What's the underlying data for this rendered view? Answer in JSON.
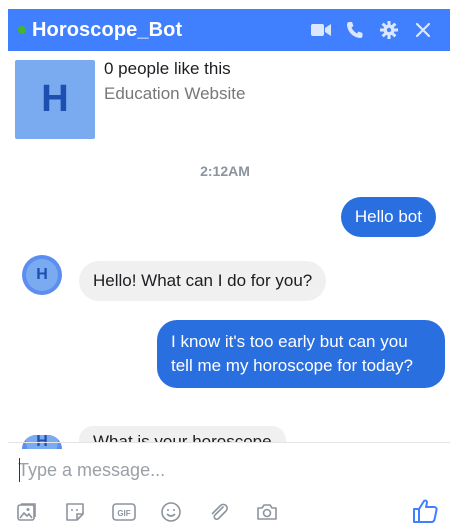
{
  "header": {
    "title": "Horoscope_Bot",
    "status": "online",
    "colors": {
      "bar": "#4080ff",
      "status_dot": "#42b72a"
    },
    "icons": [
      "video-camera-icon",
      "phone-icon",
      "gear-icon",
      "close-icon"
    ]
  },
  "page_info": {
    "avatar_letter": "H",
    "likes": "0 people like this",
    "category": "Education Website"
  },
  "conversation": {
    "timestamp": "2:12AM",
    "messages": [
      {
        "from": "user",
        "text": "Hello bot"
      },
      {
        "from": "bot",
        "avatar_letter": "H",
        "text": "Hello! What can I do for you?"
      },
      {
        "from": "user",
        "text": "I know it's too early but can you tell me my horoscope for today?"
      },
      {
        "from": "bot",
        "avatar_letter": "H",
        "text": "What is your horoscope"
      }
    ]
  },
  "composer": {
    "placeholder": "Type a message...",
    "value": "",
    "tools": [
      "image-icon",
      "sticker-icon",
      "gif-icon",
      "emoji-icon",
      "attachment-icon",
      "camera-icon"
    ],
    "send_icon": "thumbs-up-icon"
  }
}
